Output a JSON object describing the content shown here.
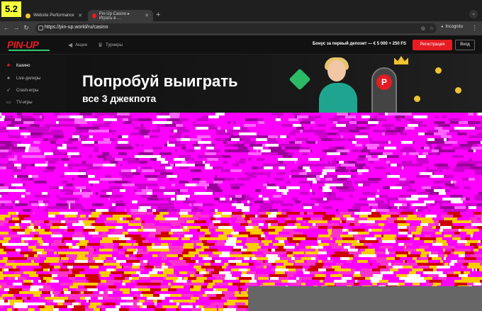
{
  "badge": "5.2",
  "tabs": [
    {
      "title": "Website Performance",
      "favicon_color": "#f0c330"
    },
    {
      "title": "Pin-Up Casino ▸ Играть в ...",
      "favicon_color": "#e51c23"
    }
  ],
  "address_bar": {
    "url": "https://pin-up.world/ru/casino"
  },
  "incognito_label": "Incognito",
  "site": {
    "logo": "PIN-UP",
    "header_nav": [
      {
        "label": "Акции",
        "icon": "megaphone-icon"
      },
      {
        "label": "Турниры",
        "icon": "trophy-icon"
      }
    ],
    "bonus_text": "Бонус за первый депозит — € 5 000 + 250 FS",
    "register_label": "Регистрация",
    "login_label": "Вход",
    "sidebar": [
      {
        "label": "Казино",
        "icon": "casino-icon",
        "active": true
      },
      {
        "label": "Live-дилеры",
        "icon": "live-icon",
        "active": false
      },
      {
        "label": "Crash-игры",
        "icon": "rocket-icon",
        "active": false
      },
      {
        "label": "TV-игры",
        "icon": "tv-icon",
        "active": false
      }
    ],
    "banner": {
      "title": "Попробуй выиграть",
      "subtitle": "все 3 джекпота"
    }
  },
  "colors": {
    "brand_red": "#e51c23",
    "brand_green": "#2ecc71",
    "accent_yellow": "#f6ff3a",
    "glitch_palette": [
      "#ff00ff",
      "#cc00cc",
      "#990099",
      "#ff33cc",
      "#ffcc00",
      "#cc0000",
      "#ff66ff",
      "#ffffff",
      "#666666"
    ]
  }
}
